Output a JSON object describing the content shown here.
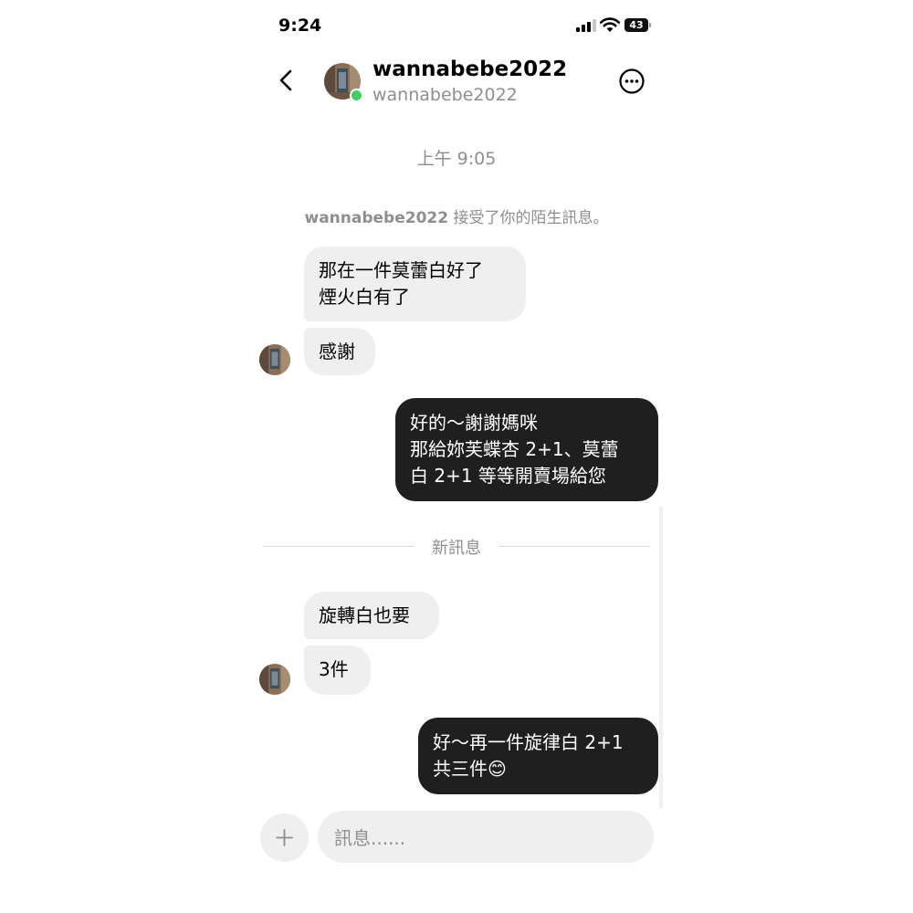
{
  "status_bar": {
    "time": "9:24",
    "battery": "43"
  },
  "header": {
    "title": "wannabebe2022",
    "subtitle": "wannabebe2022",
    "back_icon": "chevron-left-icon",
    "more_icon": "more-options-icon",
    "online": true
  },
  "conversation": {
    "timestamp": "上午 9:05",
    "notice_user": "wannabebe2022",
    "notice_text": " 接受了你的陌生訊息。",
    "messages": [
      {
        "from": "them",
        "lines": [
          "那在一件莫蕾白好了",
          "煙火白有了"
        ]
      },
      {
        "from": "them",
        "lines": [
          "感謝"
        ]
      },
      {
        "from": "me",
        "lines": [
          "好的～謝謝媽咪",
          "那給妳芙蝶杏 2+1、莫蕾",
          "白 2+1 等等開賣場給您"
        ]
      },
      {
        "from": "them",
        "lines": [
          "旋轉白也要"
        ]
      },
      {
        "from": "them",
        "lines": [
          "3件"
        ]
      },
      {
        "from": "me",
        "lines": [
          "好～再一件旋律白 2+1",
          "共三件😊"
        ]
      }
    ],
    "new_messages_label": "新訊息"
  },
  "composer": {
    "placeholder": "訊息......",
    "value": ""
  },
  "colors": {
    "incoming_bubble": "#efefef",
    "outgoing_bubble": "#1f1f1f",
    "secondary_text": "#8e8e8e",
    "online": "#3bd163"
  }
}
